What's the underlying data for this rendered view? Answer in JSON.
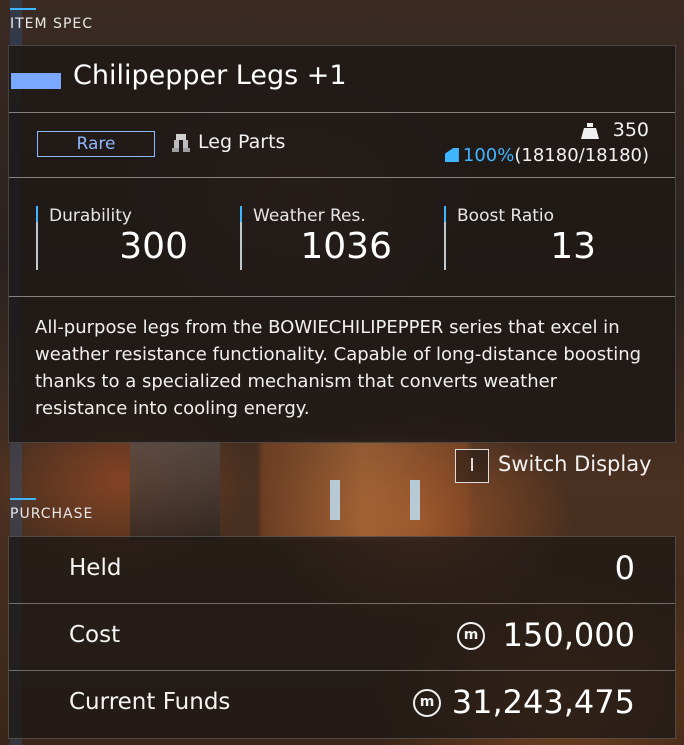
{
  "item_spec": {
    "section_label": "ITEM SPEC",
    "item_name": "Chilipepper Legs +1",
    "rarity": "Rare",
    "category_icon": "leg-parts-icon",
    "category": "Leg Parts",
    "weight_icon": "weight-icon",
    "weight": "350",
    "ap_icon": "ap-icon",
    "ap_percent": "100%",
    "ap_detail": "(18180/18180)",
    "stats": [
      {
        "label": "Durability",
        "value": "300"
      },
      {
        "label": "Weather Res.",
        "value": "1036"
      },
      {
        "label": "Boost Ratio",
        "value": "13"
      }
    ],
    "description": "All-purpose legs from the BOWIECHILIPEPPER series that excel in weather resistance functionality. Capable of long-distance boosting thanks to a specialized mechanism that converts weather resistance into cooling energy."
  },
  "switch_display": {
    "key": "I",
    "label": "Switch Display"
  },
  "purchase": {
    "section_label": "PURCHASE",
    "currency_icon": "credit-coin-icon",
    "currency_glyph": "m",
    "rows": [
      {
        "label": "Held",
        "value": "0"
      },
      {
        "label": "Cost",
        "value": "150,000"
      },
      {
        "label": "Current Funds",
        "value": "31,243,475"
      }
    ]
  },
  "colors": {
    "accent": "#3fb6ff",
    "rare": "#8fb6ff",
    "title_bar": "#7aa8ff"
  }
}
